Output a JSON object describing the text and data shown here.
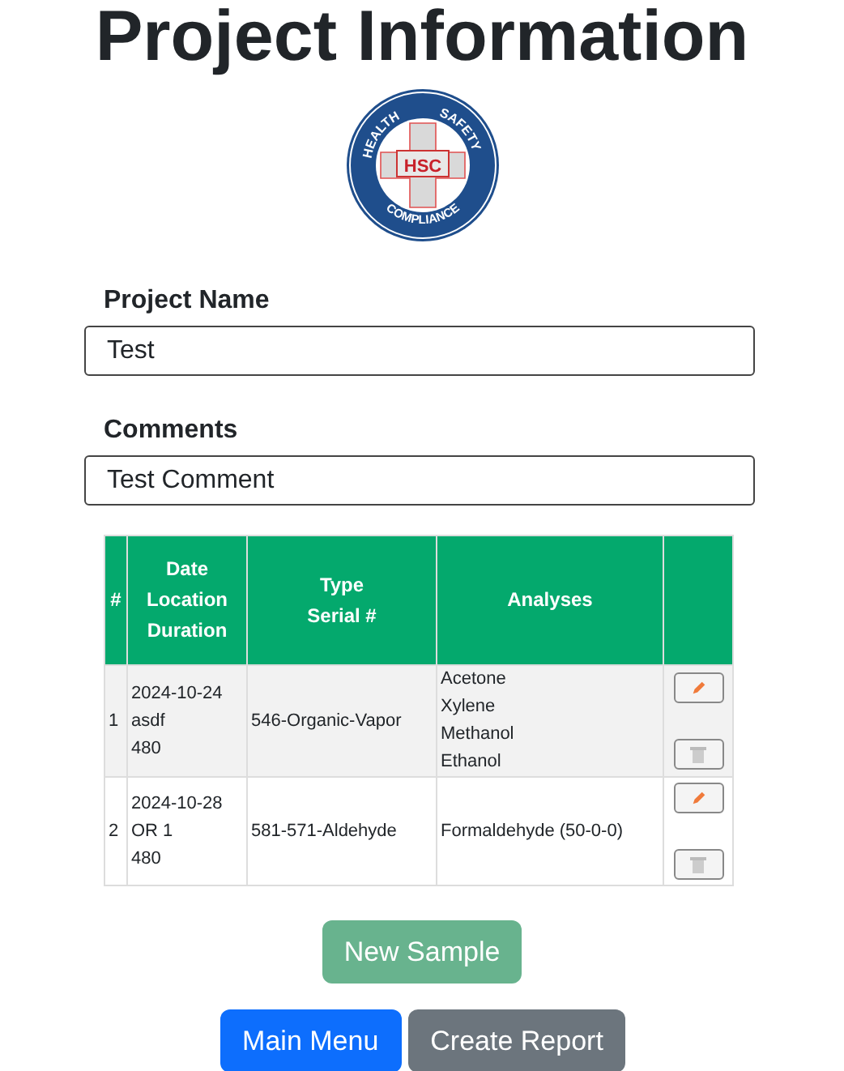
{
  "title": "Project Information",
  "logo": {
    "top_left": "HEALTH",
    "top_right": "SAFETY",
    "bottom": "COMPLIANCE",
    "center": "HSC"
  },
  "fields": [
    {
      "label": "Project Name",
      "value": "Test"
    },
    {
      "label": "Comments",
      "value": "Test Comment"
    }
  ],
  "table": {
    "columns": [
      [
        "#"
      ],
      [
        "Date",
        "Location",
        "Duration"
      ],
      [
        "Type",
        "Serial #"
      ],
      [
        "Analyses"
      ]
    ],
    "rows": [
      {
        "number": "1",
        "date": "2024-10-24",
        "location": "asdf",
        "duration": "480",
        "type_serial": "546-Organic-Vapor",
        "analyses": [
          "Acetone",
          "Xylene",
          "Methanol",
          "Ethanol"
        ]
      },
      {
        "number": "2",
        "date": "2024-10-28",
        "location": "OR 1",
        "duration": "480",
        "type_serial": "581-571-Aldehyde",
        "analyses": [
          "Formaldehyde (50-0-0)"
        ]
      }
    ]
  },
  "new_sample": {
    "label": "New Sample",
    "disabled": true
  },
  "buttons": [
    {
      "label": "Main Menu",
      "kind": "primary"
    },
    {
      "label": "Create Report",
      "kind": "secondary"
    }
  ]
}
